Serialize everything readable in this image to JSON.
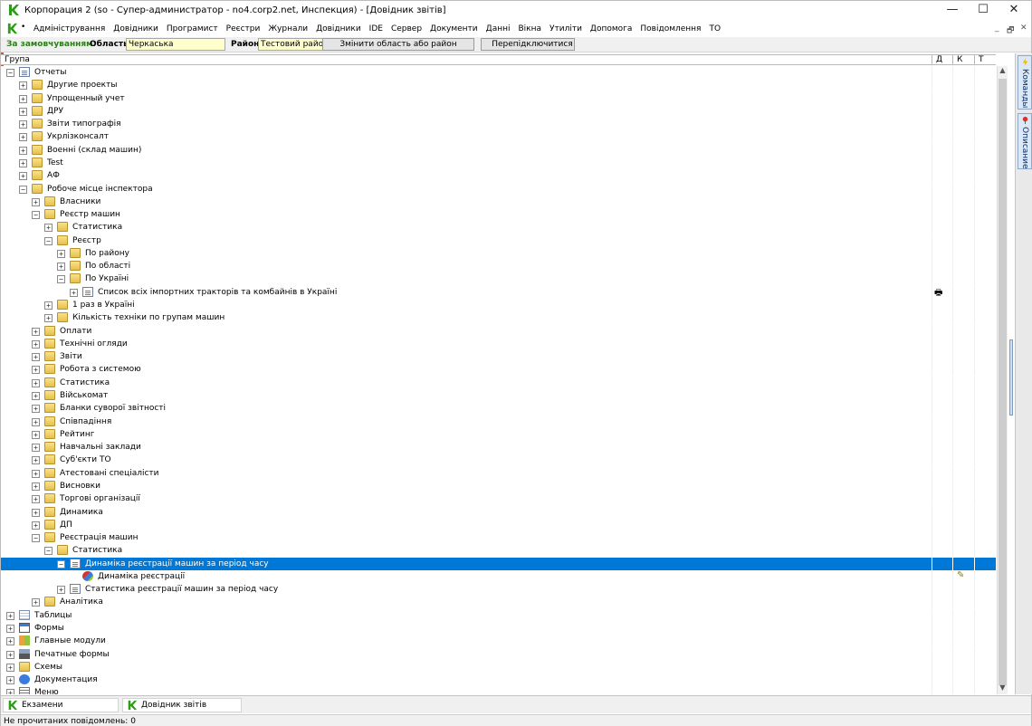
{
  "window": {
    "title": "Корпорация 2 (so - Супер-администратор - no4.corp2.net, Инспекция) - [Довідник звітів]",
    "controls": {
      "minimize": "—",
      "maximize": "☐",
      "close": "✕"
    }
  },
  "menubar": {
    "dot": "•",
    "items": [
      "Адміністрування",
      "Довідники",
      "Програмист",
      "Реєстри",
      "Журнали",
      "Довідники",
      "IDE",
      "Сервер",
      "Документи",
      "Данні",
      "Вікна",
      "Утиліти",
      "Допомога",
      "Повідомлення",
      "ТО"
    ],
    "mdi_controls": {
      "minimize": "_",
      "restore": "🗗",
      "close": "✕"
    }
  },
  "filterbar": {
    "caption": "За замовчуванням:",
    "region_label": "Область",
    "region_value": "Черкаська",
    "district_label": "Район",
    "district_value": "Тестовий район",
    "change_button": "Змінити область або район",
    "switch_button": "Перепідключитися"
  },
  "grid": {
    "columns": [
      "Група",
      "Д",
      "К",
      "Т"
    ],
    "rows": [
      {
        "text": "Отчеты",
        "level": 0,
        "expander": "−",
        "icon": "report"
      },
      {
        "text": "Другие проекты",
        "level": 1,
        "expander": "+",
        "icon": "folder"
      },
      {
        "text": "Упрощенный учет",
        "level": 1,
        "expander": "+",
        "icon": "folder"
      },
      {
        "text": "ДРУ",
        "level": 1,
        "expander": "+",
        "icon": "folder"
      },
      {
        "text": "Звіти типографія",
        "level": 1,
        "expander": "+",
        "icon": "folder"
      },
      {
        "text": "Укрлізконсалт",
        "level": 1,
        "expander": "+",
        "icon": "folder"
      },
      {
        "text": "Военні (склад машин)",
        "level": 1,
        "expander": "+",
        "icon": "folder"
      },
      {
        "text": "Test",
        "level": 1,
        "expander": "+",
        "icon": "folder"
      },
      {
        "text": "АФ",
        "level": 1,
        "expander": "+",
        "icon": "folder"
      },
      {
        "text": "Робоче місце інспектора",
        "level": 1,
        "expander": "−",
        "icon": "folder"
      },
      {
        "text": "Власники",
        "level": 2,
        "expander": "+",
        "icon": "folder"
      },
      {
        "text": "Реєстр машин",
        "level": 2,
        "expander": "−",
        "icon": "folder"
      },
      {
        "text": "Статистика",
        "level": 3,
        "expander": "+",
        "icon": "folder"
      },
      {
        "text": "Реєстр",
        "level": 3,
        "expander": "−",
        "icon": "folder"
      },
      {
        "text": "По району",
        "level": 4,
        "expander": "+",
        "icon": "folder"
      },
      {
        "text": "По області",
        "level": 4,
        "expander": "+",
        "icon": "folder"
      },
      {
        "text": "По Україні",
        "level": 4,
        "expander": "−",
        "icon": "folder"
      },
      {
        "text": "Список всіх імпортних тракторів та комбайнів в Україні",
        "level": 5,
        "expander": "+",
        "icon": "report",
        "extra": "printer"
      },
      {
        "text": "1 раз в Україні",
        "level": 3,
        "expander": "+",
        "icon": "folder"
      },
      {
        "text": "Кількість техніки по групам машин",
        "level": 3,
        "expander": "+",
        "icon": "folder"
      },
      {
        "text": "Оплати",
        "level": 2,
        "expander": "+",
        "icon": "folder"
      },
      {
        "text": "Технічні огляди",
        "level": 2,
        "expander": "+",
        "icon": "folder"
      },
      {
        "text": "Звіти",
        "level": 2,
        "expander": "+",
        "icon": "folder"
      },
      {
        "text": "Робота з системою",
        "level": 2,
        "expander": "+",
        "icon": "folder"
      },
      {
        "text": "Статистика",
        "level": 2,
        "expander": "+",
        "icon": "folder"
      },
      {
        "text": "Військомат",
        "level": 2,
        "expander": "+",
        "icon": "folder"
      },
      {
        "text": "Бланки суворої звітності",
        "level": 2,
        "expander": "+",
        "icon": "folder"
      },
      {
        "text": "Співпадіння",
        "level": 2,
        "expander": "+",
        "icon": "folder"
      },
      {
        "text": "Рейтинг",
        "level": 2,
        "expander": "+",
        "icon": "folder"
      },
      {
        "text": "Навчальні заклади",
        "level": 2,
        "expander": "+",
        "icon": "folder"
      },
      {
        "text": "Суб'єкти ТО",
        "level": 2,
        "expander": "+",
        "icon": "folder"
      },
      {
        "text": "Атестовані спеціалісти",
        "level": 2,
        "expander": "+",
        "icon": "folder"
      },
      {
        "text": "Висновки",
        "level": 2,
        "expander": "+",
        "icon": "folder"
      },
      {
        "text": "Торгові організації",
        "level": 2,
        "expander": "+",
        "icon": "folder"
      },
      {
        "text": "Динамика",
        "level": 2,
        "expander": "+",
        "icon": "folder"
      },
      {
        "text": "ДП",
        "level": 2,
        "expander": "+",
        "icon": "folder"
      },
      {
        "text": "Реєстрація машин",
        "level": 2,
        "expander": "−",
        "icon": "folder"
      },
      {
        "text": "Статистика",
        "level": 3,
        "expander": "−",
        "icon": "folder"
      },
      {
        "text": "Динаміка реєстрації машин за період часу",
        "level": 4,
        "expander": "−",
        "icon": "report",
        "selected": true
      },
      {
        "text": "Динаміка реєстрації",
        "level": 5,
        "expander": "",
        "icon": "chart",
        "extra": "edit"
      },
      {
        "text": "Статистика реєстрації машин за період часу",
        "level": 4,
        "expander": "+",
        "icon": "report"
      },
      {
        "text": "Аналітика",
        "level": 2,
        "expander": "+",
        "icon": "folder"
      },
      {
        "text": "Таблицы",
        "level": 0,
        "expander": "+",
        "icon": "table"
      },
      {
        "text": "Формы",
        "level": 0,
        "expander": "+",
        "icon": "form"
      },
      {
        "text": "Главные модули",
        "level": 0,
        "expander": "+",
        "icon": "module"
      },
      {
        "text": "Печатные формы",
        "level": 0,
        "expander": "+",
        "icon": "print"
      },
      {
        "text": "Схемы",
        "level": 0,
        "expander": "+",
        "icon": "folder"
      },
      {
        "text": "Документация",
        "level": 0,
        "expander": "+",
        "icon": "help"
      },
      {
        "text": "Меню",
        "level": 0,
        "expander": "+",
        "icon": "menu"
      }
    ]
  },
  "side_panel": {
    "tabs": [
      "Команды",
      "Описание"
    ]
  },
  "taskbar": {
    "tasks": [
      "Екзамени",
      "Довідник звітів"
    ]
  },
  "status": {
    "text": "Не прочитаних повідомлень: 0"
  },
  "colors": {
    "selection": "#0078d7",
    "brand_green": "#2e9b1a",
    "filter_input_bg": "#ffffcc"
  }
}
